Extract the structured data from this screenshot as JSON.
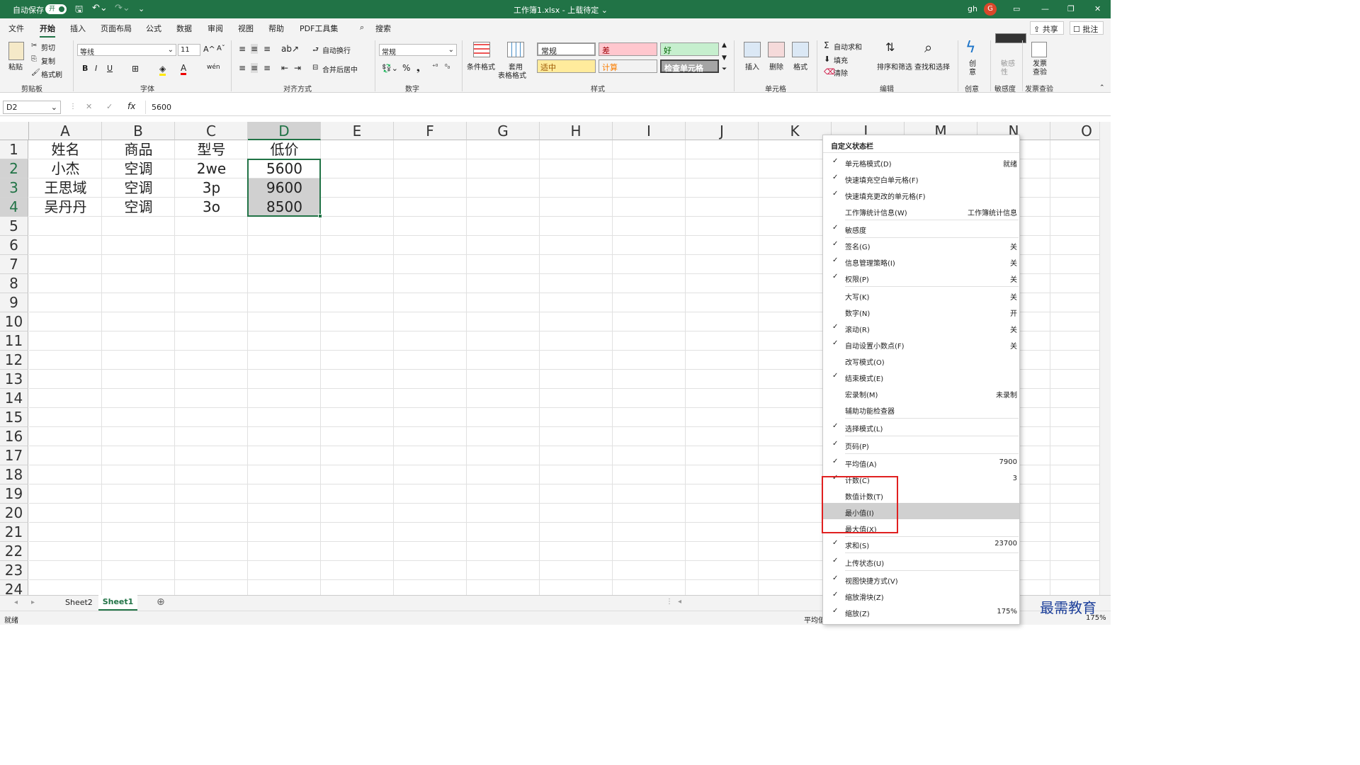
{
  "title_bar": {
    "autosave_label": "自动保存",
    "autosave_toggle": "开",
    "file_title": "工作簿1.xlsx - 上载待定 ⌄",
    "user_name": "gh",
    "user_initial": "G"
  },
  "tabs": [
    "文件",
    "开始",
    "插入",
    "页面布局",
    "公式",
    "数据",
    "审阅",
    "视图",
    "帮助",
    "PDF工具集"
  ],
  "search_label": "搜索",
  "share_label": "共享",
  "comment_label": "批注",
  "ribbon": {
    "paste": "粘贴",
    "cut": "剪切",
    "copy": "复制",
    "format_painter": "格式刷",
    "clipboard_group": "剪贴板",
    "font_name": "等线",
    "font_size": "11",
    "font_group": "字体",
    "wrap_text": "自动换行",
    "merge_center": "合并后居中",
    "align_group": "对齐方式",
    "number_format": "常规",
    "number_group": "数字",
    "cond_format": "条件格式",
    "table_format_1": "套用",
    "table_format_2": "表格格式",
    "styles": {
      "normal": "常规",
      "bad": "差",
      "good": "好",
      "neutral": "适中",
      "calc": "计算",
      "check_cell": "检查单元格"
    },
    "styles_group": "样式",
    "insert": "插入",
    "delete": "删除",
    "format": "格式",
    "cells_group": "单元格",
    "autosum": "自动求和",
    "fill": "填充",
    "clear": "清除",
    "sort_filter": "排序和筛选",
    "find_select": "查找和选择",
    "edit_group": "编辑",
    "creative": "创\n意",
    "creative_group": "创意",
    "sensitivity": "敏感\n性",
    "sensitivity_group": "敏感度",
    "invoice_check": "发票\n查验",
    "invoice_group": "发票查验"
  },
  "formula_bar": {
    "name_box": "D2",
    "formula": "5600"
  },
  "columns": [
    "A",
    "B",
    "C",
    "D",
    "E",
    "F",
    "G",
    "H",
    "I",
    "J",
    "K",
    "L",
    "M",
    "N",
    "O"
  ],
  "rows": [
    "1",
    "2",
    "3",
    "4",
    "5",
    "6",
    "7",
    "8",
    "9",
    "10",
    "11",
    "12",
    "13",
    "14",
    "15",
    "16",
    "17",
    "18",
    "19",
    "20",
    "21",
    "22",
    "23",
    "24"
  ],
  "cells": [
    [
      "姓名",
      "商品",
      "型号",
      "低价"
    ],
    [
      "小杰",
      "空调",
      "2we",
      "5600"
    ],
    [
      "王思域",
      "空调",
      "3p",
      "9600"
    ],
    [
      "吴丹丹",
      "空调",
      "3o",
      "8500"
    ]
  ],
  "sheets": [
    "Sheet2",
    "Sheet1"
  ],
  "active_sheet": "Sheet1",
  "status": {
    "mode": "就绪",
    "avg_partial": "平均值",
    "zoom": "175%"
  },
  "context_menu": {
    "title": "自定义状态栏",
    "items": [
      {
        "label": "单元格模式(D)",
        "checked": true,
        "value": "就绪"
      },
      {
        "label": "快速填充空白单元格(F)",
        "checked": true,
        "value": ""
      },
      {
        "label": "快速填充更改的单元格(F)",
        "checked": true,
        "value": ""
      },
      {
        "label": "工作簿统计信息(W)",
        "checked": false,
        "value": "工作簿统计信息"
      },
      {
        "label": "敏感度",
        "checked": true,
        "value": ""
      },
      {
        "label": "签名(G)",
        "checked": true,
        "value": "关"
      },
      {
        "label": "信息管理策略(I)",
        "checked": true,
        "value": "关"
      },
      {
        "label": "权限(P)",
        "checked": true,
        "value": "关"
      },
      {
        "label": "大写(K)",
        "checked": false,
        "value": "关"
      },
      {
        "label": "数字(N)",
        "checked": false,
        "value": "开"
      },
      {
        "label": "滚动(R)",
        "checked": true,
        "value": "关"
      },
      {
        "label": "自动设置小数点(F)",
        "checked": true,
        "value": "关"
      },
      {
        "label": "改写模式(O)",
        "checked": false,
        "value": ""
      },
      {
        "label": "结束模式(E)",
        "checked": true,
        "value": ""
      },
      {
        "label": "宏录制(M)",
        "checked": false,
        "value": "未录制"
      },
      {
        "label": "辅助功能检查器",
        "checked": false,
        "value": ""
      },
      {
        "label": "选择模式(L)",
        "checked": true,
        "value": ""
      },
      {
        "label": "页码(P)",
        "checked": true,
        "value": ""
      },
      {
        "label": "平均值(A)",
        "checked": true,
        "value": "7900"
      },
      {
        "label": "计数(C)",
        "checked": true,
        "value": "3"
      },
      {
        "label": "数值计数(T)",
        "checked": false,
        "value": ""
      },
      {
        "label": "最小值(I)",
        "checked": false,
        "value": ""
      },
      {
        "label": "最大值(X)",
        "checked": false,
        "value": ""
      },
      {
        "label": "求和(S)",
        "checked": true,
        "value": "23700"
      },
      {
        "label": "上传状态(U)",
        "checked": true,
        "value": ""
      },
      {
        "label": "视图快捷方式(V)",
        "checked": true,
        "value": ""
      },
      {
        "label": "缩放滑块(Z)",
        "checked": true,
        "value": ""
      },
      {
        "label": "缩放(Z)",
        "checked": true,
        "value": "175%"
      }
    ]
  },
  "watermark": "最需教育",
  "colors": {
    "excel_green": "#217346",
    "highlight_red": "#e02020",
    "hover_gray": "#d0d0d0"
  }
}
